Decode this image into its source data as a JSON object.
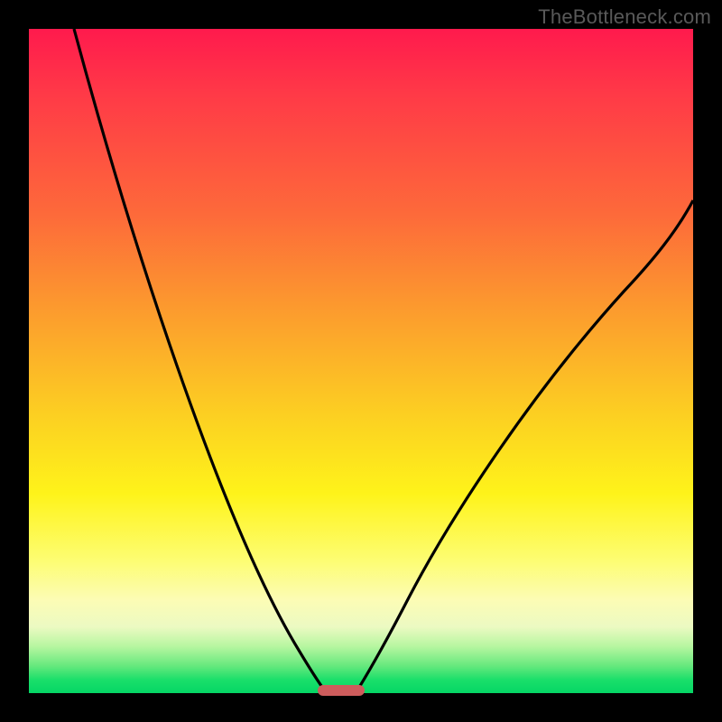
{
  "attribution": "TheBottleneck.com",
  "colors": {
    "gradient_top": "#ff1a4d",
    "gradient_mid": "#fef31a",
    "gradient_bottom": "#05d665",
    "curve": "#000000",
    "frame": "#000000",
    "marker": "#cd5c5c",
    "attribution_text": "#595959"
  },
  "chart_data": {
    "type": "line",
    "title": "",
    "xlabel": "",
    "ylabel": "",
    "xlim": [
      0,
      100
    ],
    "ylim": [
      0,
      100
    ],
    "grid": false,
    "series": [
      {
        "name": "left-curve",
        "x": [
          7,
          10,
          14,
          18,
          22,
          26,
          30,
          34,
          38,
          41,
          43,
          44.5
        ],
        "y": [
          100,
          90,
          78,
          66,
          55,
          44,
          33,
          23,
          13,
          6,
          2,
          0
        ]
      },
      {
        "name": "right-curve",
        "x": [
          49,
          51,
          54,
          58,
          63,
          69,
          76,
          84,
          92,
          100
        ],
        "y": [
          0,
          3,
          8,
          15,
          24,
          34,
          45,
          56,
          66,
          75
        ]
      }
    ],
    "marker": {
      "x_center": 47,
      "width_pct": 7,
      "y": 0
    }
  }
}
